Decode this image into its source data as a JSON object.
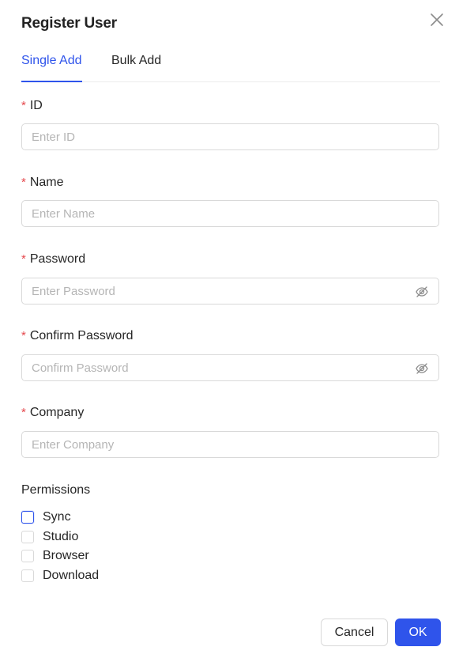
{
  "dialog": {
    "title": "Register User",
    "tabs": [
      {
        "label": "Single Add",
        "active": true
      },
      {
        "label": "Bulk Add",
        "active": false
      }
    ],
    "required_mark": "*",
    "fields": [
      {
        "label": "ID",
        "placeholder": "Enter ID",
        "value": ""
      },
      {
        "label": "Name",
        "placeholder": "Enter Name",
        "value": ""
      },
      {
        "label": "Password",
        "placeholder": "Enter Password",
        "value": ""
      },
      {
        "label": "Confirm Password",
        "placeholder": "Confirm Password",
        "value": ""
      },
      {
        "label": "Company",
        "placeholder": "Enter Company",
        "value": ""
      }
    ],
    "permissions": {
      "title": "Permissions",
      "options": [
        {
          "label": "Sync",
          "checked": false
        },
        {
          "label": "Studio",
          "checked": false
        },
        {
          "label": "Browser",
          "checked": false
        },
        {
          "label": "Download",
          "checked": false
        }
      ]
    },
    "buttons": {
      "cancel": "Cancel",
      "ok": "OK"
    },
    "icons": {
      "close": "close-icon",
      "password_visibility": "eye-off-icon"
    },
    "colors": {
      "primary": "#2f54eb",
      "required": "#e5484d",
      "border": "#d9d9d9"
    }
  }
}
